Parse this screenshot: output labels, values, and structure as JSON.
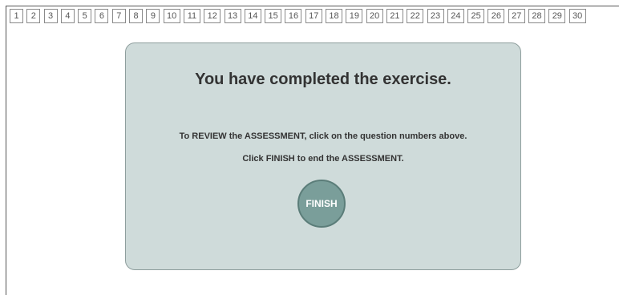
{
  "question_nav": {
    "items": [
      "1",
      "2",
      "3",
      "4",
      "5",
      "6",
      "7",
      "8",
      "9",
      "10",
      "11",
      "12",
      "13",
      "14",
      "15",
      "16",
      "17",
      "18",
      "19",
      "20",
      "21",
      "22",
      "23",
      "24",
      "25",
      "26",
      "27",
      "28",
      "29",
      "30"
    ]
  },
  "completion_panel": {
    "title": "You have completed the exercise.",
    "review_instruction": "To REVIEW the ASSESSMENT, click on the question numbers above.",
    "finish_instruction": "Click FINISH to end the ASSESSMENT.",
    "finish_label": "FINISH"
  },
  "colors": {
    "panel_background": "#cfdbda",
    "finish_button": "#7a9e9a"
  }
}
